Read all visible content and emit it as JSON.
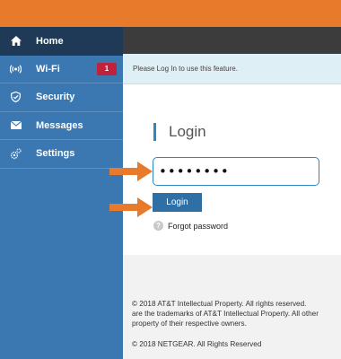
{
  "sidebar": {
    "items": [
      {
        "label": "Home",
        "icon": "home-icon",
        "active": true
      },
      {
        "label": "Wi-Fi",
        "icon": "wifi-icon",
        "badge": "1"
      },
      {
        "label": "Security",
        "icon": "shield-icon"
      },
      {
        "label": "Messages",
        "icon": "envelope-icon"
      },
      {
        "label": "Settings",
        "icon": "gear-icon"
      }
    ]
  },
  "notice": "Please Log In to use this feature.",
  "login": {
    "title": "Login",
    "password_value": "••••••••",
    "button_label": "Login",
    "forgot_label": "Forgot password"
  },
  "footer": {
    "copyright_lines": [
      "© 2018 AT&T Intellectual Property. All rights reserved.",
      "are the trademarks of AT&T Intellectual Property. All other",
      "property of their respective owners."
    ],
    "netgear": "© 2018 NETGEAR. All Rights Reserved"
  },
  "colors": {
    "top_bar": "#e87a2c",
    "sidebar": "#3b78b2",
    "sidebar_active": "#1e3a57",
    "badge": "#c0213b",
    "accent": "#2f86c4",
    "arrow": "#e87a2c"
  }
}
